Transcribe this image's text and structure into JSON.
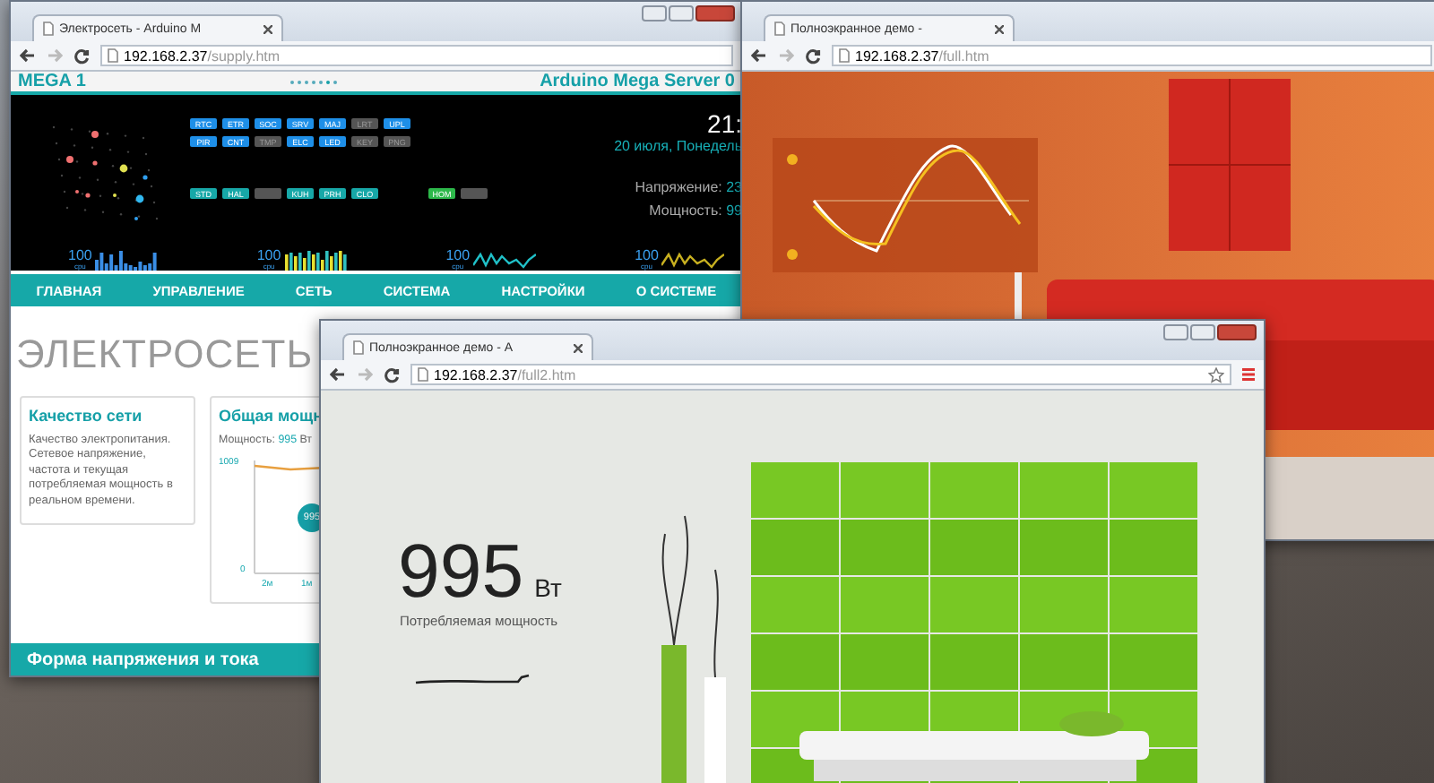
{
  "supply_window": {
    "tab_title": "Электросеть - Arduino M",
    "url_host": "192.168.2.37",
    "url_path": "/supply.htm",
    "header": {
      "left": "MEGA 1",
      "right": "Arduino Mega Server 0"
    },
    "badge_rows": [
      [
        {
          "label": "RTC",
          "on": true,
          "color": "#1e8fe8"
        },
        {
          "label": "ETR",
          "on": true,
          "color": "#1e8fe8"
        },
        {
          "label": "SOC",
          "on": true,
          "color": "#1e8fe8"
        },
        {
          "label": "SRV",
          "on": true,
          "color": "#1e8fe8"
        },
        {
          "label": "MAJ",
          "on": true,
          "color": "#1e8fe8"
        },
        {
          "label": "LRT",
          "on": false
        },
        {
          "label": "UPL",
          "on": true,
          "color": "#1e8fe8"
        }
      ],
      [
        {
          "label": "PIR",
          "on": true,
          "color": "#1e8fe8"
        },
        {
          "label": "CNT",
          "on": true,
          "color": "#1e8fe8"
        },
        {
          "label": "TMP",
          "on": false
        },
        {
          "label": "ELC",
          "on": true,
          "color": "#1e8fe8"
        },
        {
          "label": "LED",
          "on": true,
          "color": "#1e8fe8"
        },
        {
          "label": "KEY",
          "on": false
        },
        {
          "label": "PNG",
          "on": false
        }
      ],
      [
        {
          "label": "STD",
          "on": true,
          "color": "#17a8a8"
        },
        {
          "label": "HAL",
          "on": true,
          "color": "#17a8a8"
        },
        {
          "on": false
        },
        {
          "label": "KUH",
          "on": true,
          "color": "#17a8a8"
        },
        {
          "label": "PRH",
          "on": true,
          "color": "#17a8a8"
        },
        {
          "label": "CLO",
          "on": true,
          "color": "#17a8a8"
        },
        {
          "kind": "gap"
        },
        {
          "label": "HOM",
          "on": true,
          "color": "#2db84a"
        },
        {
          "on": false
        }
      ]
    ],
    "time": "21:",
    "date": "20 июля, Понедель",
    "readings": [
      {
        "label": "Напряжение:",
        "value": "23"
      },
      {
        "label": "Мощность:",
        "value": "99"
      }
    ],
    "cpu_meters": [
      {
        "value": "100",
        "unit": "cpu",
        "kind": "bars",
        "color": "#3a8ee6"
      },
      {
        "value": "100",
        "unit": "cpu",
        "kind": "bars",
        "color": "#e8e030"
      },
      {
        "value": "100",
        "unit": "cpu",
        "kind": "wave",
        "color": "#20c0c8"
      },
      {
        "value": "100",
        "unit": "cpu",
        "kind": "wave",
        "color": "#c8b020"
      }
    ],
    "nav": [
      "ГЛАВНАЯ",
      "УПРАВЛЕНИЕ",
      "СЕТЬ",
      "СИСТЕМА",
      "НАСТРОЙКИ",
      "О СИСТЕМЕ"
    ],
    "page_title": "ЭЛЕКТРОСЕТЬ",
    "quality_card": {
      "title": "Качество сети",
      "text": "Качество электропитания. Сетевое напряжение, частота и текущая потребляемая мощность в реальном времени."
    },
    "power_card": {
      "title": "Общая мощн",
      "label": "Мощность:",
      "value": "995",
      "unit": "Вт",
      "y_ticks": [
        "1009",
        "0"
      ],
      "x_ticks": [
        "2м",
        "1м"
      ],
      "marker": "995"
    },
    "section_bar": "Форма напряжения и тока"
  },
  "full_window": {
    "tab_title": "Полноэкранное демо -",
    "url_host": "192.168.2.37",
    "url_path": "/full.htm"
  },
  "full2_window": {
    "tab_title": "Полноэкранное демо - А",
    "url_host": "192.168.2.37",
    "url_path": "/full2.htm",
    "reading": "995",
    "unit": "Вт",
    "caption": "Потребляемая мощность"
  }
}
